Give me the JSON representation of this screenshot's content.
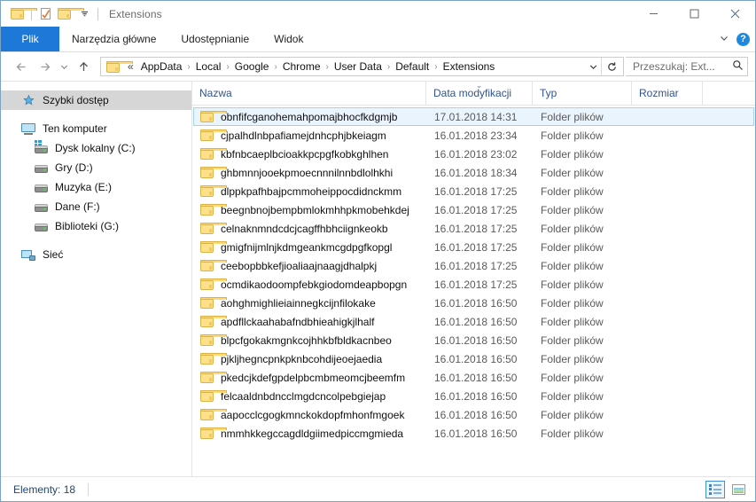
{
  "window": {
    "title": "Extensions",
    "quick_access": [
      "folder-icon",
      "properties-icon",
      "new-folder-icon",
      "customize-chevron"
    ],
    "controls": {
      "minimize": "minimize-icon",
      "maximize": "maximize-icon",
      "close": "close-icon"
    }
  },
  "ribbon": {
    "file_tab": "Plik",
    "tabs": [
      "Narzędzia główne",
      "Udostępnianie",
      "Widok"
    ],
    "collapse_icon": "chevron-down-icon",
    "help_label": "?"
  },
  "address": {
    "back_icon": "back-arrow-icon",
    "forward_icon": "forward-arrow-icon",
    "recent_icon": "chevron-down-icon",
    "up_icon": "up-arrow-icon",
    "overflow": "«",
    "crumbs": [
      "AppData",
      "Local",
      "Google",
      "Chrome",
      "User Data",
      "Default",
      "Extensions"
    ],
    "separator": "›",
    "dropdown_icon": "chevron-down-icon",
    "refresh_icon": "refresh-icon",
    "search_placeholder": "Przeszukaj: Ext..."
  },
  "sidebar": {
    "items": [
      {
        "label": "Szybki dostęp",
        "icon": "star-pin-icon",
        "selected": true,
        "indent": false
      },
      {
        "label": "Ten komputer",
        "icon": "computer-icon",
        "selected": false,
        "indent": false
      },
      {
        "label": "Dysk lokalny (C:)",
        "icon": "system-drive-icon",
        "selected": false,
        "indent": true
      },
      {
        "label": "Gry (D:)",
        "icon": "drive-icon",
        "selected": false,
        "indent": true
      },
      {
        "label": "Muzyka (E:)",
        "icon": "drive-icon",
        "selected": false,
        "indent": true
      },
      {
        "label": "Dane (F:)",
        "icon": "drive-icon",
        "selected": false,
        "indent": true
      },
      {
        "label": "Biblioteki (G:)",
        "icon": "drive-icon",
        "selected": false,
        "indent": true
      },
      {
        "label": "Sieć",
        "icon": "network-icon",
        "selected": false,
        "indent": false
      }
    ]
  },
  "columns": {
    "name": "Nazwa",
    "date": "Data modyfikacji",
    "type": "Typ",
    "size": "Rozmiar",
    "sort_indicator": "⌄"
  },
  "files": [
    {
      "name": "obnfifcganohemahpomajbhocfkdgmjb",
      "date": "17.01.2018 14:31",
      "type": "Folder plików",
      "size": "",
      "selected": true
    },
    {
      "name": "cjpalhdlnbpafiamejdnhcphjbkeiagm",
      "date": "16.01.2018 23:34",
      "type": "Folder plików",
      "size": "",
      "selected": false
    },
    {
      "name": "kbfnbcaeplbcioakkpcpgfkobkghlhen",
      "date": "16.01.2018 23:02",
      "type": "Folder plików",
      "size": "",
      "selected": false
    },
    {
      "name": "ghbmnnjooekpmoecnnnilnnbdlolhkhi",
      "date": "16.01.2018 18:34",
      "type": "Folder plików",
      "size": "",
      "selected": false
    },
    {
      "name": "dlppkpafhbajpcmmoheippocdidnckmm",
      "date": "16.01.2018 17:25",
      "type": "Folder plików",
      "size": "",
      "selected": false
    },
    {
      "name": "beegnbnojbempbmlokmhhpkmobehkdej",
      "date": "16.01.2018 17:25",
      "type": "Folder plików",
      "size": "",
      "selected": false
    },
    {
      "name": "celnaknmndcdcjcagffhbhciignkeokb",
      "date": "16.01.2018 17:25",
      "type": "Folder plików",
      "size": "",
      "selected": false
    },
    {
      "name": "gmigfnijmlnjkdmgeankmcgdpgfkopgl",
      "date": "16.01.2018 17:25",
      "type": "Folder plików",
      "size": "",
      "selected": false
    },
    {
      "name": "ceebopbbkefjioaliaajnaagjdhalpkj",
      "date": "16.01.2018 17:25",
      "type": "Folder plików",
      "size": "",
      "selected": false
    },
    {
      "name": "ocmdikaodoompfebkgiodomdeapbopgn",
      "date": "16.01.2018 17:25",
      "type": "Folder plików",
      "size": "",
      "selected": false
    },
    {
      "name": "aohghmighlieiainnegkcijnfilokake",
      "date": "16.01.2018 16:50",
      "type": "Folder plików",
      "size": "",
      "selected": false
    },
    {
      "name": "apdfllckaahabafndbhieahigkjlhalf",
      "date": "16.01.2018 16:50",
      "type": "Folder plików",
      "size": "",
      "selected": false
    },
    {
      "name": "blpcfgokakmgnkcojhhkbfbldkacnbeo",
      "date": "16.01.2018 16:50",
      "type": "Folder plików",
      "size": "",
      "selected": false
    },
    {
      "name": "pjkljhegncpnkpknbcohdijeoejaedia",
      "date": "16.01.2018 16:50",
      "type": "Folder plików",
      "size": "",
      "selected": false
    },
    {
      "name": "pkedcjkdefgpdelpbcmbmeomcjbeemfm",
      "date": "16.01.2018 16:50",
      "type": "Folder plików",
      "size": "",
      "selected": false
    },
    {
      "name": "felcaaldnbdncclmgdcncolpebgiejap",
      "date": "16.01.2018 16:50",
      "type": "Folder plików",
      "size": "",
      "selected": false
    },
    {
      "name": "aapocclcgogkmnckokdopfmhonfmgoek",
      "date": "16.01.2018 16:50",
      "type": "Folder plików",
      "size": "",
      "selected": false
    },
    {
      "name": "nmmhkkegccagdldgiimedpiccmgmieda",
      "date": "16.01.2018 16:50",
      "type": "Folder plików",
      "size": "",
      "selected": false
    }
  ],
  "status": {
    "items_text": "Elementy: 18",
    "details_view_icon": "details-view-icon",
    "large_icons_view_icon": "large-icons-view-icon"
  },
  "colors": {
    "accent": "#1e78d7",
    "selection_fill": "#eaf4fc",
    "selection_border": "#a9d2f0",
    "folder_yellow": "#fde08a",
    "header_text": "#30538f"
  }
}
